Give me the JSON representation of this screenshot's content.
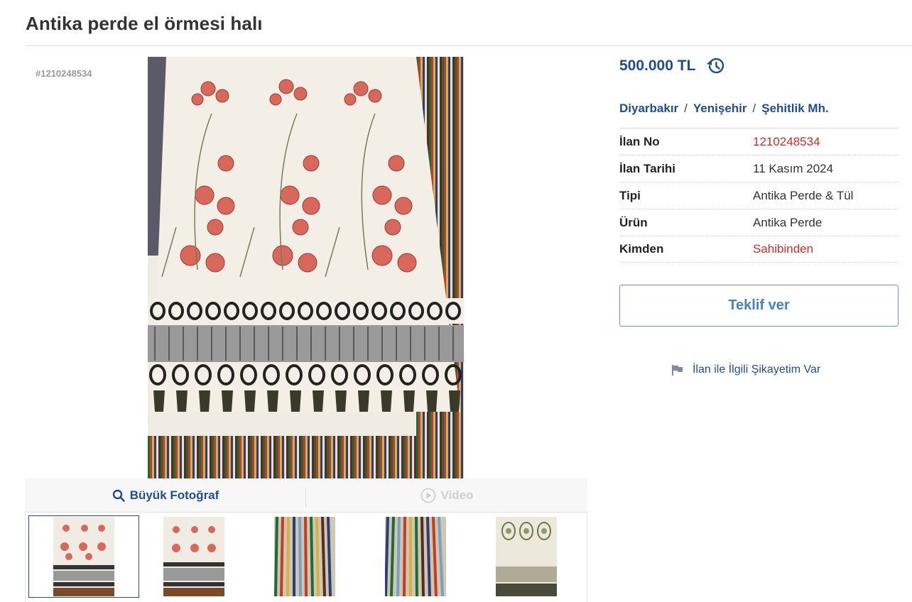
{
  "listing": {
    "title": "Antika perde el örmesi halı",
    "photo_id": "#1210248534"
  },
  "photo_tabs": {
    "big_photo_label": "Büyük Fotoğraf",
    "video_label": "Video"
  },
  "thumbnails": [
    {
      "name": "thumb-1",
      "active": true
    },
    {
      "name": "thumb-2",
      "active": false
    },
    {
      "name": "thumb-3",
      "active": false
    },
    {
      "name": "thumb-4",
      "active": false
    },
    {
      "name": "thumb-5",
      "active": false
    }
  ],
  "price": {
    "value": "500.000 TL",
    "icon": "history-icon"
  },
  "location": {
    "city": "Diyarbakır",
    "district": "Yenişehir",
    "neighborhood": "Şehitlik Mh.",
    "separator": "/"
  },
  "info": [
    {
      "label": "İlan No",
      "value": "1210248534",
      "value_color": "#d42929"
    },
    {
      "label": "İlan Tarihi",
      "value": "11 Kasım 2024"
    },
    {
      "label": "Tipi",
      "value": "Antika Perde & Tül"
    },
    {
      "label": "Ürün",
      "value": "Antika Perde"
    },
    {
      "label": "Kimden",
      "value": "Sahibinden",
      "value_color": "#d42929"
    }
  ],
  "actions": {
    "offer_label": "Teklif ver",
    "complaint_label": "İlan ile İlgili Şikayetim Var"
  },
  "colors": {
    "brand_blue": "#1f4d8f",
    "accent_red": "#d42929"
  }
}
